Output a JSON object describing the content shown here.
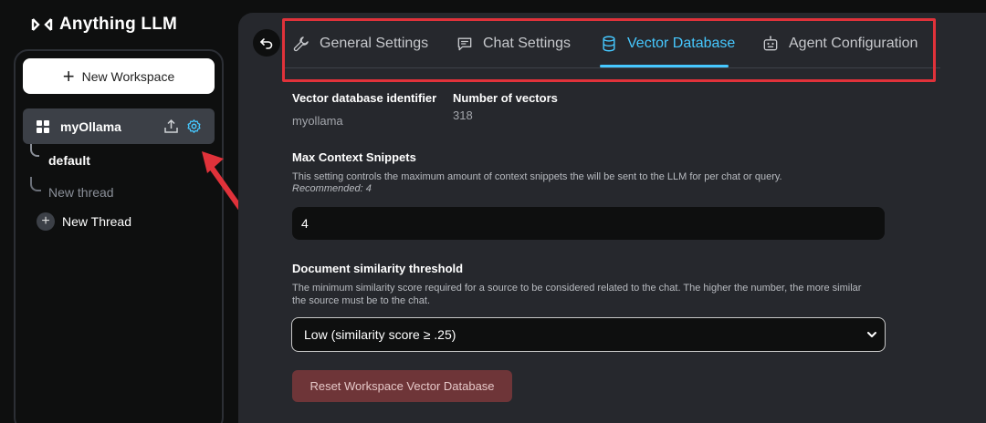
{
  "app": {
    "title": "Anything LLM"
  },
  "sidebar": {
    "new_workspace_label": "New Workspace",
    "workspace": {
      "name": "myOllama"
    },
    "threads": [
      {
        "label": "default"
      },
      {
        "label": "New thread"
      }
    ],
    "new_thread_label": "New Thread"
  },
  "tabs": [
    {
      "label": "General Settings",
      "icon": "wrench-icon",
      "active": false
    },
    {
      "label": "Chat Settings",
      "icon": "chat-bubble-icon",
      "active": false
    },
    {
      "label": "Vector Database",
      "icon": "database-icon",
      "active": true
    },
    {
      "label": "Agent Configuration",
      "icon": "robot-icon",
      "active": false
    }
  ],
  "vector": {
    "identifier_label": "Vector database identifier",
    "identifier_value": "myollama",
    "count_label": "Number of vectors",
    "count_value": "318"
  },
  "snippets": {
    "label": "Max Context Snippets",
    "description": "This setting controls the maximum amount of context snippets the will be sent to the LLM for per chat or query.",
    "recommended": "Recommended: 4",
    "value": "4"
  },
  "similarity": {
    "label": "Document similarity threshold",
    "description_line1": "The minimum similarity score required for a source to be considered related to the chat. The higher the number, the more similar",
    "description_line2": "the source must be to the chat.",
    "selected": "Low (similarity score ≥ .25)"
  },
  "reset_label": "Reset Workspace Vector Database",
  "colors": {
    "accent": "#46c8ff",
    "highlight": "#e0323a",
    "danger": "#6e3538"
  }
}
